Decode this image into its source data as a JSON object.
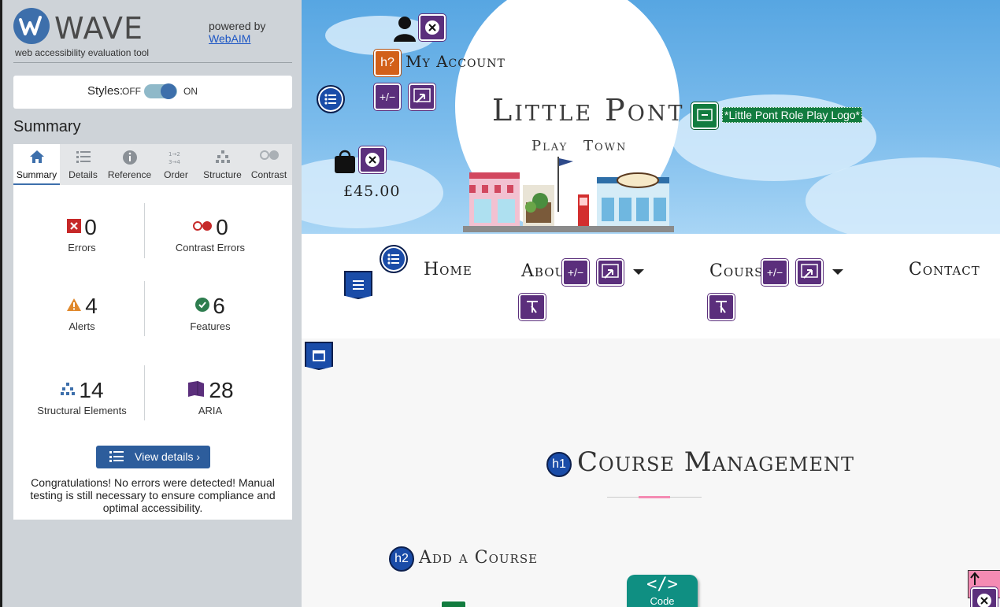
{
  "wave": {
    "title": "WAVE",
    "subtitle": "web accessibility evaluation tool",
    "powered_by": "powered by",
    "webaim_link": "WebAIM",
    "styles_label": "Styles:",
    "styles_off": "OFF",
    "styles_on": "ON",
    "summary_heading": "Summary",
    "tabs": [
      {
        "label": "Summary",
        "icon": "home-icon",
        "active": true
      },
      {
        "label": "Details",
        "icon": "list-icon"
      },
      {
        "label": "Reference",
        "icon": "info-icon"
      },
      {
        "label": "Order",
        "icon": "order-icon"
      },
      {
        "label": "Structure",
        "icon": "structure-icon"
      },
      {
        "label": "Contrast",
        "icon": "contrast-icon"
      }
    ],
    "stats": {
      "errors": {
        "count": "0",
        "label": "Errors",
        "color": "#c62828"
      },
      "contrast_errors": {
        "count": "0",
        "label": "Contrast Errors",
        "color": "#c62828"
      },
      "alerts": {
        "count": "4",
        "label": "Alerts",
        "color": "#e0882b"
      },
      "features": {
        "count": "6",
        "label": "Features",
        "color": "#2e7d4f"
      },
      "structural": {
        "count": "14",
        "label": "Structural Elements",
        "color": "#3d6fab"
      },
      "aria": {
        "count": "28",
        "label": "ARIA",
        "color": "#5b2f7c"
      }
    },
    "view_details_label": "View details ›",
    "congrats": "Congratulations! No errors were detected! Manual testing is still necessary to ensure compliance and optimal accessibility."
  },
  "site": {
    "account_label": "My Account",
    "price": "£45.00",
    "logo_title": "Little Pont",
    "logo_play": "Play",
    "logo_town": "Town",
    "logo_alt": "*Little Pont Role Play Logo*",
    "nav": {
      "home": "Home",
      "about": "About",
      "courses": "Courses",
      "contact": "Contact"
    },
    "h1_badge": "h1",
    "h1": "Course Management",
    "h2_badge": "h2",
    "h2": "Add a Course",
    "code_badge": "Code",
    "alert_icon_text": "h?",
    "plusminus": "+/−"
  }
}
